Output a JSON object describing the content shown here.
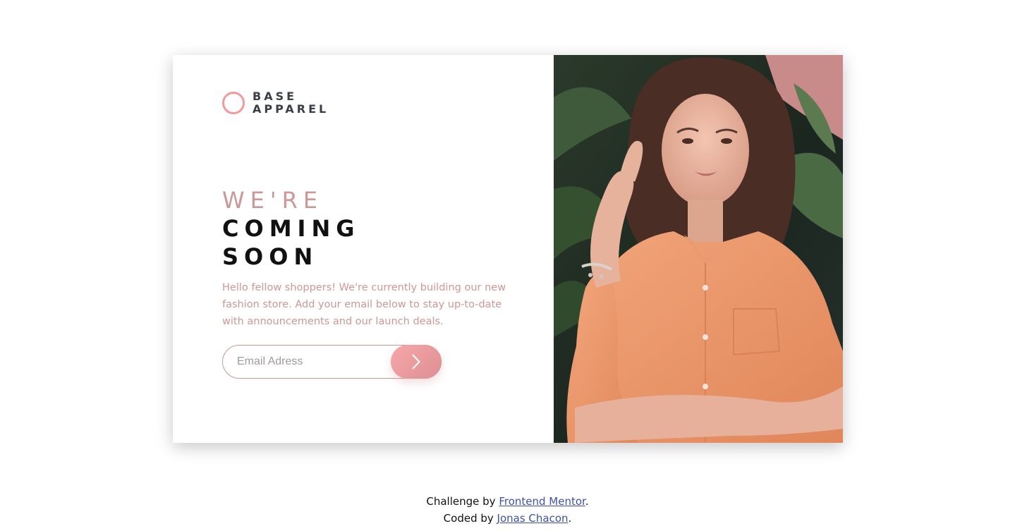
{
  "brand": {
    "name_line1": "BASE",
    "name_line2": "APPAREL",
    "accent_color": "#f4999b",
    "text_color": "#3b3e45",
    "logo_icon": "ring-icon"
  },
  "hero": {
    "heading_light": "WE'RE",
    "heading_bold_line1": "COMING",
    "heading_bold_line2": "SOON",
    "description": "Hello fellow shoppers! We're currently building our new fashion store. Add your email below to stay up-to-date with announcements and our launch deals.",
    "text_color": "#ce9797"
  },
  "form": {
    "email_placeholder": "Email Adress",
    "email_value": "",
    "submit_icon": "chevron-right-icon",
    "button_gradient": [
      "#f6a7a8",
      "#de8f93"
    ]
  },
  "footer": {
    "line1_prefix": "Challenge by",
    "line1_link": "Frontend Mentor",
    "line1_suffix": ".",
    "line2_prefix": "Coded by",
    "line2_link": "Jonas Chacon",
    "line2_suffix": ".",
    "link_color": "#3e52a3"
  }
}
